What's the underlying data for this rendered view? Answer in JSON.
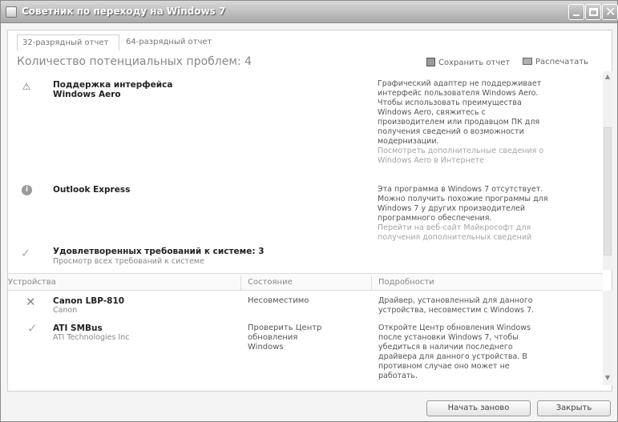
{
  "window": {
    "title": "Советник по переходу на Windows 7"
  },
  "tabs": [
    {
      "label": "32-разрядный отчет"
    },
    {
      "label": "64-разрядный отчет"
    }
  ],
  "summary": {
    "count_text": "Количество потенциальных проблем: 4",
    "save_label": "Сохранить отчет",
    "print_label": "Распечатать"
  },
  "issues": [
    {
      "icon": "warning-icon",
      "title_line1": "Поддержка интерфейса",
      "title_line2": "Windows Aero",
      "desc": [
        "Графический адаптер не поддерживает",
        "интерфейс пользователя Windows Aero.",
        "Чтобы использовать преимущества",
        "Windows Aero, свяжитесь с",
        "производителем или продавцом ПК для",
        "получения сведений о возможности",
        "модернизации."
      ],
      "link": [
        "Посмотреть дополнительные сведения о",
        "Windows Aero в Интернете"
      ]
    },
    {
      "icon": "info-icon",
      "title_line1": "Outlook Express",
      "desc": [
        "Эта программа в Windows 7 отсутствует.",
        "Можно получить похожие программы для",
        "Windows 7 у других производителей",
        "программного обеспечения."
      ],
      "link": [
        "Перейти на веб-сайт Майкрософт для",
        "получения дополнительных сведений"
      ]
    },
    {
      "icon": "check-icon",
      "title_line1": "Удовлетворенных требований к системе: 3",
      "subtitle": "Просмотр всех требований к системе"
    }
  ],
  "devices": {
    "columns": [
      "Устройства",
      "Состояние",
      "Подробности"
    ],
    "rows": [
      {
        "icon": "cross-icon",
        "name": "Canon LBP-810",
        "vendor": "Canon",
        "status": [
          "Несовместимо"
        ],
        "details": [
          "Драйвер, установленный для данного",
          "устройства, несовместим с Windows 7."
        ]
      },
      {
        "icon": "check-icon",
        "name": "ATI SMBus",
        "vendor": "ATI Technologies Inc",
        "status": [
          "Проверить Центр",
          "обновления",
          "Windows"
        ],
        "details": [
          "Откройте Центр обновления Windows",
          "после установки Windows 7, чтобы",
          "убедиться в наличии последнего",
          "драйвера для данного устройства. В",
          "противном случае оно может не",
          "работать."
        ]
      }
    ]
  },
  "footer": {
    "restart_label": "Начать заново",
    "close_label": "Закрыть"
  }
}
